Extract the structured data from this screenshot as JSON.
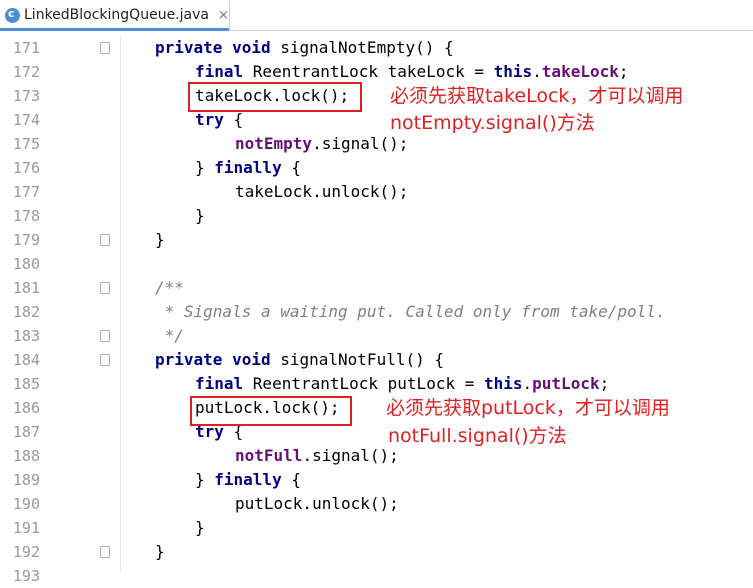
{
  "tab": {
    "title": "LinkedBlockingQueue.java",
    "close": "×",
    "icon": "java-class-icon",
    "accent": "#4a8fd1"
  },
  "annotation_color": "#e02020",
  "lines": [
    {
      "n": "171",
      "indent": 1,
      "fold": true,
      "tokens": [
        [
          "kw",
          "private void "
        ],
        [
          "",
          "signalNotEmpty() {"
        ]
      ]
    },
    {
      "n": "172",
      "indent": 2,
      "fold": false,
      "tokens": [
        [
          "kw",
          "final "
        ],
        [
          "",
          "ReentrantLock takeLock = "
        ],
        [
          "kw",
          "this"
        ],
        [
          "",
          "."
        ],
        [
          "field",
          "takeLock"
        ],
        [
          "",
          ";"
        ]
      ]
    },
    {
      "n": "173",
      "indent": 2,
      "fold": false,
      "tokens": [
        [
          "",
          "takeLock.lock();"
        ]
      ]
    },
    {
      "n": "174",
      "indent": 2,
      "fold": false,
      "tokens": [
        [
          "kw",
          "try "
        ],
        [
          "",
          "{"
        ]
      ]
    },
    {
      "n": "175",
      "indent": 3,
      "fold": false,
      "tokens": [
        [
          "field",
          "notEmpty"
        ],
        [
          "",
          ".signal();"
        ]
      ]
    },
    {
      "n": "176",
      "indent": 2,
      "fold": false,
      "tokens": [
        [
          "",
          "} "
        ],
        [
          "kw",
          "finally "
        ],
        [
          "",
          "{"
        ]
      ]
    },
    {
      "n": "177",
      "indent": 3,
      "fold": false,
      "tokens": [
        [
          "",
          "takeLock.unlock();"
        ]
      ]
    },
    {
      "n": "178",
      "indent": 2,
      "fold": false,
      "tokens": [
        [
          "",
          "}"
        ]
      ]
    },
    {
      "n": "179",
      "indent": 1,
      "fold": true,
      "tokens": [
        [
          "",
          "}"
        ]
      ]
    },
    {
      "n": "180",
      "indent": 0,
      "fold": false,
      "tokens": []
    },
    {
      "n": "181",
      "indent": 1,
      "fold": true,
      "tokens": [
        [
          "cm",
          "/**"
        ]
      ]
    },
    {
      "n": "182",
      "indent": 1,
      "fold": false,
      "tokens": [
        [
          "cm",
          " * Signals a waiting put. Called only from take/poll."
        ]
      ]
    },
    {
      "n": "183",
      "indent": 1,
      "fold": true,
      "tokens": [
        [
          "cm",
          " */"
        ]
      ]
    },
    {
      "n": "184",
      "indent": 1,
      "fold": true,
      "tokens": [
        [
          "kw",
          "private void "
        ],
        [
          "",
          "signalNotFull() {"
        ]
      ]
    },
    {
      "n": "185",
      "indent": 2,
      "fold": false,
      "tokens": [
        [
          "kw",
          "final "
        ],
        [
          "",
          "ReentrantLock putLock = "
        ],
        [
          "kw",
          "this"
        ],
        [
          "",
          "."
        ],
        [
          "field",
          "putLock"
        ],
        [
          "",
          ";"
        ]
      ]
    },
    {
      "n": "186",
      "indent": 2,
      "fold": false,
      "tokens": [
        [
          "",
          "putLock.lock();"
        ]
      ]
    },
    {
      "n": "187",
      "indent": 2,
      "fold": false,
      "tokens": [
        [
          "kw",
          "try "
        ],
        [
          "",
          "{"
        ]
      ]
    },
    {
      "n": "188",
      "indent": 3,
      "fold": false,
      "tokens": [
        [
          "field",
          "notFull"
        ],
        [
          "",
          ".signal();"
        ]
      ]
    },
    {
      "n": "189",
      "indent": 2,
      "fold": false,
      "tokens": [
        [
          "",
          "} "
        ],
        [
          "kw",
          "finally "
        ],
        [
          "",
          "{"
        ]
      ]
    },
    {
      "n": "190",
      "indent": 3,
      "fold": false,
      "tokens": [
        [
          "",
          "putLock.unlock();"
        ]
      ]
    },
    {
      "n": "191",
      "indent": 2,
      "fold": false,
      "tokens": [
        [
          "",
          "}"
        ]
      ]
    },
    {
      "n": "192",
      "indent": 1,
      "fold": true,
      "tokens": [
        [
          "",
          "}"
        ]
      ]
    },
    {
      "n": "193",
      "indent": 0,
      "fold": false,
      "tokens": []
    }
  ],
  "annotations": {
    "take_line1": "必须先获取takeLock，才可以调用",
    "take_line2": "notEmpty.signal()方法",
    "put_line1": "必须先获取putLock，才可以调用",
    "put_line2": "notFull.signal()方法"
  }
}
